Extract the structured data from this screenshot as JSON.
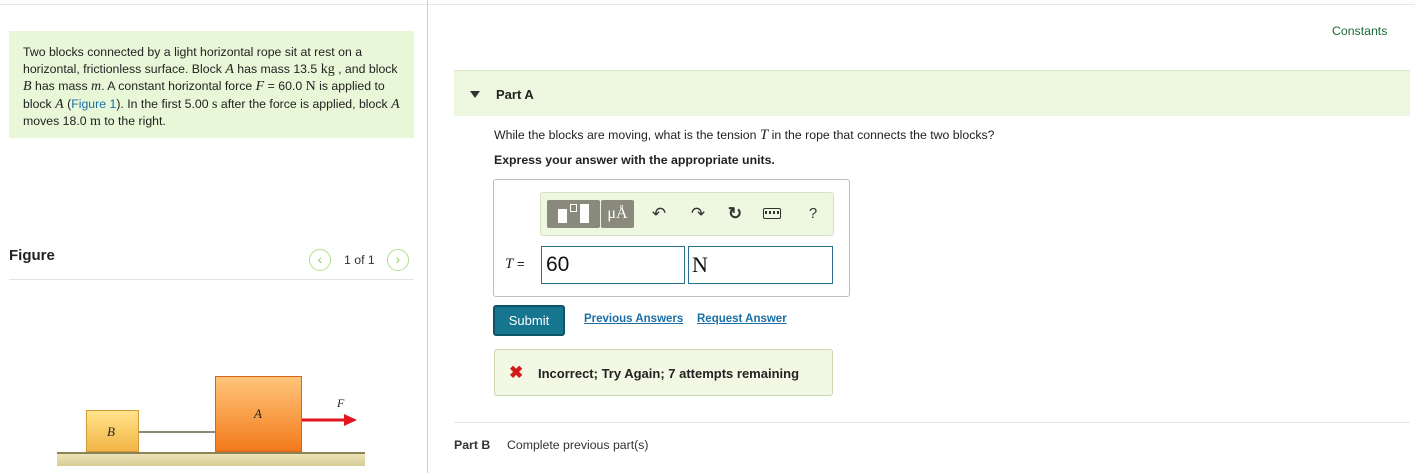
{
  "problem": {
    "t1": "Two blocks connected by a light horizontal rope sit at rest on a horizontal, frictionless surface. Block ",
    "var_a": "A",
    "t2": " has mass 13.5 ",
    "unit_kg": "kg",
    "t3": " , and block ",
    "var_b": "B",
    "t4": " has mass ",
    "var_m": "m",
    "t5": ". A constant horizontal force ",
    "var_f": "F",
    "t6": " = 60.0 ",
    "unit_n": "N",
    "t7": " is applied to block ",
    "var_a2": "A",
    "t8": " (",
    "figure_link": "Figure 1",
    "t9": "). In the first 5.00 ",
    "unit_s": "s",
    "t10": " after the force is applied, block ",
    "var_a3": "A",
    "t11": " moves 18.0 ",
    "unit_m": "m",
    "t12": " to the right."
  },
  "figure": {
    "title": "Figure",
    "pager": "1 of 1",
    "block_a_label": "A",
    "block_b_label": "B",
    "force_label": "F",
    "force_color": "#e0151d"
  },
  "constants_link": "Constants",
  "partA": {
    "label": "Part A",
    "question_pre": "While the blocks are moving, what is the tension ",
    "question_var": "T",
    "question_post": " in the rope that connects the two blocks?",
    "instruction": "Express your answer with the appropriate units.",
    "toolbar": {
      "units_label": "μÅ",
      "help_label": "?",
      "icons": [
        "templates-icon",
        "units-icon",
        "undo-icon",
        "redo-icon",
        "reset-icon",
        "keyboard-icon",
        "help-icon"
      ]
    },
    "answer_label_var": "T",
    "answer_label_eq": " =",
    "value": "60",
    "unit": "N",
    "submit_label": "Submit",
    "previous_answers_label": "Previous Answers",
    "request_answer_label": "Request Answer",
    "feedback": "Incorrect; Try Again; 7 attempts remaining",
    "feedback_icon_color": "#d21a1a"
  },
  "partB": {
    "label": "Part B",
    "status": "Complete previous part(s)"
  },
  "colors": {
    "accent_teal": "#16768f",
    "panel_green": "#e8f7d8",
    "link_blue": "#1b6ea6"
  }
}
